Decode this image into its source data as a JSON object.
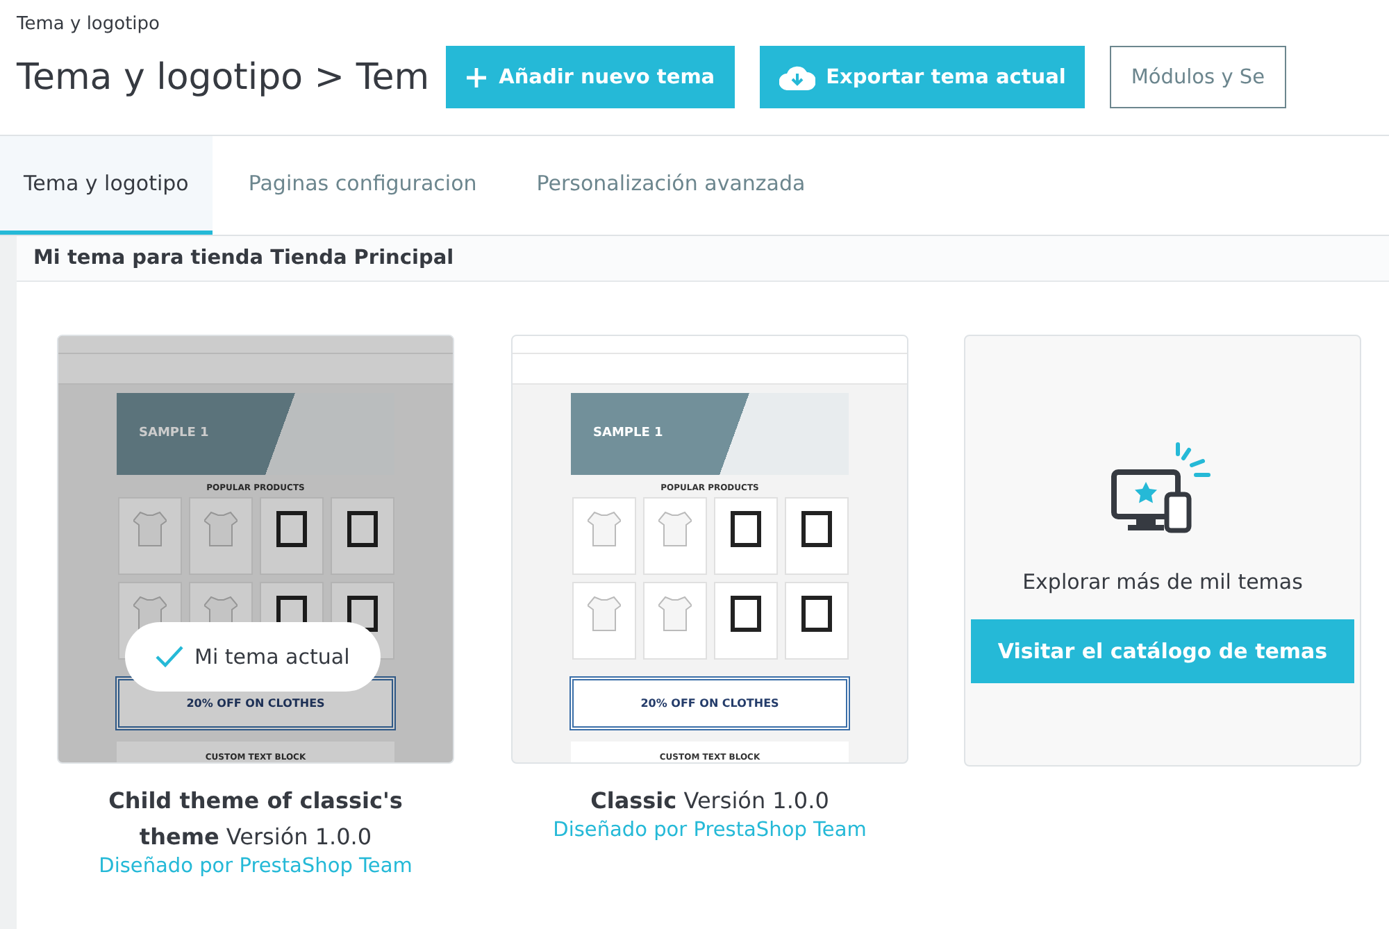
{
  "breadcrumb": "Tema y logotipo",
  "page_title": "Tema y logotipo > Tem",
  "toolbar_buttons": [
    {
      "label": "Añadir nuevo tema",
      "kind": "add"
    },
    {
      "label": "Exportar tema actual",
      "kind": "export"
    },
    {
      "label": "Módulos y Se",
      "kind": "outline"
    }
  ],
  "tabs": [
    {
      "label": "Tema y logotipo",
      "selected": true
    },
    {
      "label": "Paginas configuracion",
      "selected": false
    },
    {
      "label": "Personalización avanzada",
      "selected": false
    }
  ],
  "panel": {
    "title": "Mi tema para tienda Tienda Principal"
  },
  "themes": [
    {
      "name": "**Child theme of classic's theme** Versión 1.0.0",
      "author": "Diseñado por PrestaShop Team",
      "current": true,
      "current_label": "Mi tema actual",
      "preview": {
        "banner": "SAMPLE 1",
        "section": "POPULAR PRODUCTS",
        "promo": "20% OFF ON CLOTHES",
        "block": "CUSTOM TEXT BLOCK"
      }
    },
    {
      "name": "**Classic** Versión 1.0.0",
      "author": "Diseñado por PrestaShop Team",
      "current": false,
      "preview": {
        "banner": "SAMPLE 1",
        "section": "POPULAR PRODUCTS",
        "promo": "20% OFF ON CLOTHES",
        "block": "CUSTOM TEXT BLOCK"
      }
    }
  ],
  "catalog": {
    "text": "Explorar más de mil temas",
    "button": "Visitar el catálogo de temas"
  }
}
